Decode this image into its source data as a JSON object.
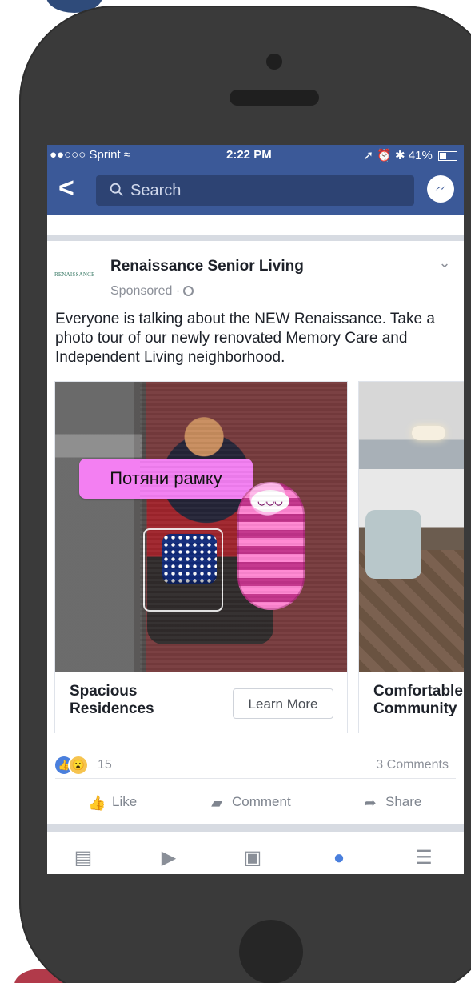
{
  "status_bar": {
    "carrier": "●●○○○ Sprint ≈",
    "time": "2:22 PM",
    "battery": "41%",
    "icons": "➚ ⏰ ✱"
  },
  "navigation": {
    "back_icon": "<",
    "search_placeholder": "Search",
    "messenger_icon": "messenger-icon"
  },
  "post": {
    "logo_text": "RENAISSANCE",
    "advertiser": "Renaissance Senior Living",
    "sponsored": "Sponsored ·",
    "menu_icon": "⌄",
    "text": "Everyone is talking about the NEW Renaissance. Take a photo tour of our newly renovated Memory Care and Independent Living neighborhood."
  },
  "carousel": {
    "hint_text": "Потяни рамку",
    "cards": [
      {
        "title": "Spacious Residences",
        "button": "Learn More"
      },
      {
        "title": "Comfortable Community"
      }
    ]
  },
  "engagement": {
    "reactions_count": "15",
    "comments": "3 Comments",
    "actions": {
      "like": "Like",
      "comment": "Comment",
      "share": "Share"
    }
  },
  "colors": {
    "facebook_blue": "#3b5998",
    "hint_pink": "#f37ff2"
  }
}
